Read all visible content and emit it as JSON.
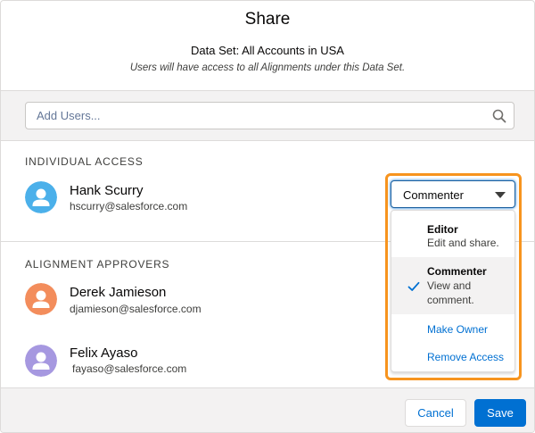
{
  "modal": {
    "title": "Share",
    "subtitle": "Data Set: All Accounts in USA",
    "description": "Users will have access to all Alignments under this Data Set."
  },
  "search": {
    "placeholder": "Add Users...",
    "icon": "search-icon"
  },
  "individual_access": {
    "label": "INDIVIDUAL ACCESS",
    "users": [
      {
        "name": "Hank Scurry",
        "email": "hscurry@salesforce.com",
        "avatar_color": "#4bb0ea",
        "access": "Commenter"
      }
    ]
  },
  "alignment_approvers": {
    "label": "ALIGNMENT APPROVERS",
    "users": [
      {
        "name": "Derek Jamieson",
        "email": "djamieson@salesforce.com",
        "avatar_color": "#f38d5c"
      },
      {
        "name": "Felix Ayaso",
        "email": "fayaso@salesforce.com",
        "avatar_color": "#a698e0"
      }
    ]
  },
  "access_dropdown": {
    "selected": "Commenter",
    "options": [
      {
        "title": "Editor",
        "description": "Edit and share."
      },
      {
        "title": "Commenter",
        "description": "View and comment.",
        "selected": true
      }
    ],
    "actions": [
      "Make Owner",
      "Remove Access"
    ]
  },
  "footer": {
    "cancel_label": "Cancel",
    "save_label": "Save"
  },
  "colors": {
    "brand": "#0070d2",
    "highlight": "#f7941e"
  }
}
